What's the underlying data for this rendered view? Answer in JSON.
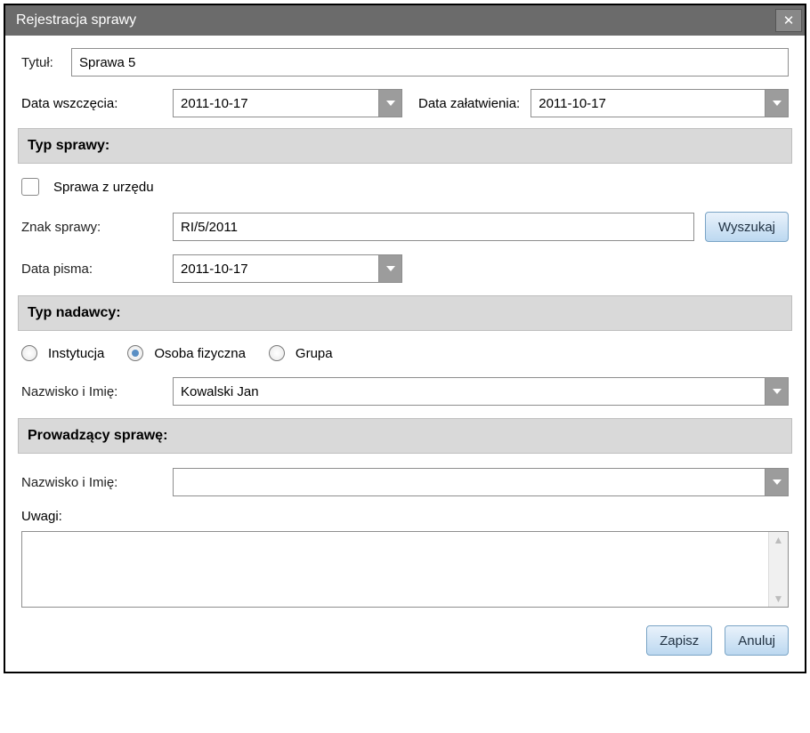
{
  "window": {
    "title": "Rejestracja sprawy"
  },
  "labels": {
    "tytul": "Tytuł:",
    "data_wszczecia": "Data wszczęcia:",
    "data_zalatwienia": "Data załatwienia:",
    "typ_sprawy_header": "Typ sprawy:",
    "sprawa_z_urzedu": "Sprawa z urzędu",
    "znak_sprawy": "Znak sprawy:",
    "data_pisma": "Data pisma:",
    "typ_nadawcy_header": "Typ nadawcy:",
    "instytucja": "Instytucja",
    "osoba_fizyczna": "Osoba fizyczna",
    "grupa": "Grupa",
    "nazwisko_imie": "Nazwisko i Imię:",
    "prowadzacy_header": "Prowadzący sprawę:",
    "uwagi": "Uwagi:"
  },
  "values": {
    "tytul": "Sprawa 5",
    "data_wszczecia": "2011-10-17",
    "data_zalatwienia": "2011-10-17",
    "sprawa_z_urzedu_checked": false,
    "znak_sprawy": "RI/5/2011",
    "data_pisma": "2011-10-17",
    "nadawca_selected": "osoba_fizyczna",
    "nadawca_nazwisko": "Kowalski Jan",
    "prowadzacy_nazwisko": "",
    "uwagi": ""
  },
  "buttons": {
    "wyszukaj": "Wyszukaj",
    "zapisz": "Zapisz",
    "anuluj": "Anuluj"
  }
}
